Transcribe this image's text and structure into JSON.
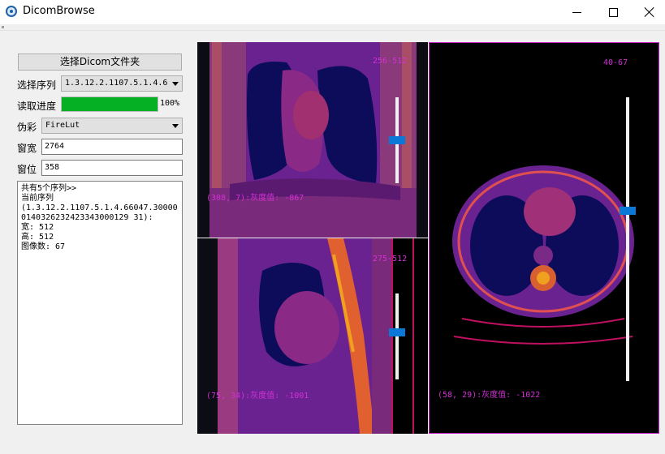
{
  "window": {
    "title": "DicomBrowse"
  },
  "controls": {
    "open_button_label": "选择Dicom文件夹",
    "series_label": "选择序列",
    "series_value": "1.3.12.2.1107.5.1.4.6",
    "progress_label": "读取进度",
    "progress_value": 1.0,
    "progress_text": "100%",
    "lut_label": "伪彩",
    "lut_value": "FireLut",
    "window_width_label": "窗宽",
    "window_width_value": "2764",
    "window_level_label": "窗位",
    "window_level_value": "358"
  },
  "info": {
    "lines": [
      "共有5个序列>>",
      "当前序列",
      "(1.3.12.2.1107.5.1.4.66047.30000",
      "0140326232423343000129 31):",
      "宽: 512",
      "高: 512",
      "图像数: 67"
    ]
  },
  "viewports": {
    "coronal": {
      "slice": "256-512",
      "readout": "(308, 7):灰度值: -867",
      "slider_value": 0.5
    },
    "sagittal": {
      "slice": "275-512",
      "readout": "(75, 34):灰度值: -1001",
      "slider_value": 0.45
    },
    "axial": {
      "slice": "40-67",
      "readout": "(58, 29):灰度值: -1022",
      "slider_value": 0.4
    }
  },
  "colors": {
    "accent": "#0a78d7",
    "progress": "#06b025",
    "overlay_text": "#d230d6"
  }
}
